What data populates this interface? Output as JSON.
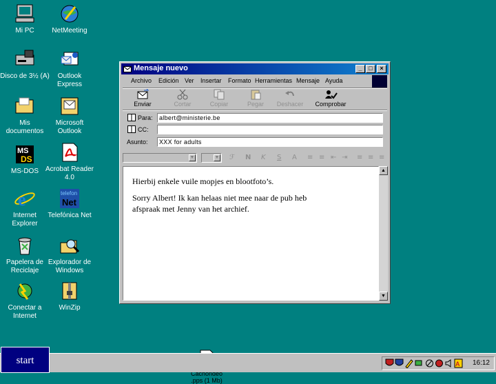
{
  "desktop": {
    "icons": [
      {
        "label": "Mi PC",
        "icon": "my-computer-icon"
      },
      {
        "label": "NetMeeting",
        "icon": "netmeeting-icon"
      },
      {
        "label": "Disco de 3½ (A)",
        "icon": "floppy-drive-icon"
      },
      {
        "label": "Outlook Express",
        "icon": "outlook-express-icon"
      },
      {
        "label": "Mis documentos",
        "icon": "folder-icon"
      },
      {
        "label": "Microsoft Outlook",
        "icon": "outlook-icon"
      },
      {
        "label": "MS-DOS",
        "icon": "ms-dos-icon"
      },
      {
        "label": "Acrobat Reader 4.0",
        "icon": "acrobat-icon"
      },
      {
        "label": "Internet Explorer",
        "icon": "internet-explorer-icon"
      },
      {
        "label": "Telefónica Net",
        "icon": "telefonica-icon"
      },
      {
        "label": "Papelera de Reciclaje",
        "icon": "recycle-bin-icon"
      },
      {
        "label": "Explorador de Windows",
        "icon": "explorer-icon"
      },
      {
        "label": "Conectar a Internet",
        "icon": "connect-icon"
      },
      {
        "label": "WinZip",
        "icon": "winzip-icon"
      }
    ]
  },
  "window": {
    "title": "Mensaje nuevo",
    "menu": [
      "Archivo",
      "Edición",
      "Ver",
      "Insertar",
      "Formato",
      "Herramientas",
      "Mensaje",
      "Ayuda"
    ],
    "toolbar": [
      {
        "label": "Enviar",
        "icon": "send-icon",
        "enabled": true
      },
      {
        "label": "Cortar",
        "icon": "cut-icon",
        "enabled": false
      },
      {
        "label": "Copiar",
        "icon": "copy-icon",
        "enabled": false
      },
      {
        "label": "Pegar",
        "icon": "paste-icon",
        "enabled": false
      },
      {
        "label": "Deshacer",
        "icon": "undo-icon",
        "enabled": false
      },
      {
        "label": "Comprobar",
        "icon": "check-names-icon",
        "enabled": true
      }
    ],
    "header": {
      "to_label": "Para:",
      "to_value": "albert@ministerie.be",
      "cc_label": "CC:",
      "cc_value": "",
      "subject_label": "Asunto:",
      "subject_value": "XXX for adults"
    },
    "body": {
      "line1": "Hierbij enkele vuile mopjes en blootfoto’s.",
      "paragraph": "Sorry Albert! Ik kan helaas niet mee naar de pub heb afspraak met Jenny van het archief."
    },
    "attachment": {
      "name": "Cachondeo",
      "size": ".pps (1 Mb)"
    }
  },
  "taskbar": {
    "start_label": "start",
    "clock": "16:12"
  }
}
